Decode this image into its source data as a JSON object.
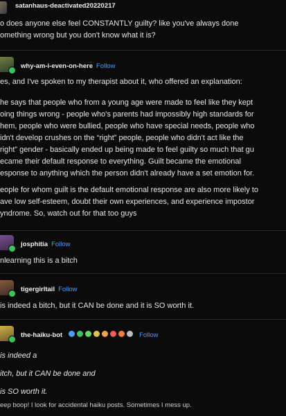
{
  "thread": {
    "op": {
      "username": "satanhaus-deactivated20220217",
      "lines": [
        "o does anyone else feel CONSTANTLY guilty? like you've always done",
        "omething wrong but you don't know what it is?"
      ]
    },
    "reply1": {
      "username": "why-am-i-even-on-here",
      "follow_label": "Follow",
      "para1": [
        "es, and I've spoken to my therapist about it, who offered an explanation:"
      ],
      "para2": [
        "he says that people who from a young age were made to feel like they kept",
        "oing things wrong - people who's parents had impossibly high standards for",
        "hem, people who were bullied, people who have special needs, people who",
        "idn't develop crushes on the “right” people, people who didn't act like the",
        "right” gender - basically ended up being made to feel guilty so much that gu",
        "ecame their default response to everything. Guilt became the emotional",
        "esponse to anything which the person didn't already have a set emotion for."
      ],
      "para3": [
        "eople for whom guilt is the default emotional response are also more likely to",
        "ave low self-esteem, doubt their own experiences, and experience impostor",
        "yndrome. So, watch out for that too guys"
      ]
    },
    "reply2": {
      "username": "josphitia",
      "follow_label": "Follow",
      "text": "nlearning this is a bitch"
    },
    "reply3": {
      "username": "tigergirltail",
      "follow_label": "Follow",
      "text": "is indeed a bitch, but it CAN be done and it is SO worth it."
    },
    "reply4": {
      "username": "the-haiku-bot",
      "follow_label": "Follow",
      "haiku": [
        "is indeed a",
        "itch, but it CAN be done and",
        "is SO worth it."
      ],
      "footer": "eep boop! I look for accidental haiku posts. Sometimes I mess up."
    }
  },
  "colors": {
    "background": "#0b0b0b",
    "text": "#e6e6e6",
    "follow": "#4a9eff",
    "badge_green": "#3bc45a"
  }
}
